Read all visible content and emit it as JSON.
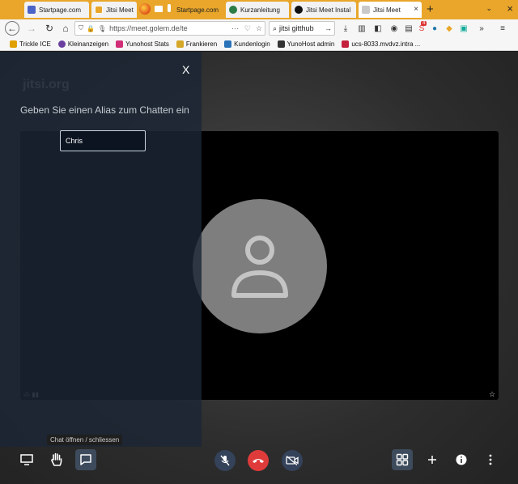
{
  "browser": {
    "tabs": [
      {
        "title": "Startpage.com",
        "favicon_color": "#4a63c7",
        "active": false
      },
      {
        "title": "Jitsi Meet",
        "favicon_color": "#ffffff",
        "active": false
      },
      {
        "title": "Startpage.com",
        "favicon_color": "#4a63c7",
        "active": false
      },
      {
        "title": "Kurzanleitung",
        "favicon_color": "#2d7d46",
        "active": false
      },
      {
        "title": "Jitsi Meet Instal",
        "favicon_color": "#111111",
        "active": false
      },
      {
        "title": "Jitsi Meet",
        "favicon_color": "#c9c9c9",
        "active": true
      }
    ],
    "tab_close": "×",
    "new_tab": "+",
    "tab_overflow": "⌄",
    "window_close": "×",
    "url": "https://meet.golem.de/te",
    "url_more": "···",
    "search_value": "jitsi gitthub",
    "search_go": "→",
    "addon_badge": "4"
  },
  "bookmarks": [
    {
      "label": "Trickle ICE",
      "icon_color": "#e0a000"
    },
    {
      "label": "Kleinanzeigen",
      "icon_color": "#6b3fa0"
    },
    {
      "label": "Yunohost Stats",
      "icon_color": "#d12e78"
    },
    {
      "label": "Frankieren",
      "icon_color": "#d6a82a"
    },
    {
      "label": "Kundenlogin",
      "icon_color": "#2a73b8"
    },
    {
      "label": "YunoHost admin",
      "icon_color": "#333333"
    },
    {
      "label": "ucs-8033.mvdvz.intra ...",
      "icon_color": "#c4213d"
    }
  ],
  "jitsi": {
    "watermark": "jitsi.org",
    "chat": {
      "close_label": "X",
      "heading": "Geben Sie einen Alias zum Chatten ein",
      "alias_value": "Chris"
    },
    "tooltip": "Chat öffnen / schliessen",
    "indicators": "⁂ ▮▮",
    "star": "☆"
  },
  "icons": {
    "screen": "desktop-icon",
    "hand": "raise-hand-icon",
    "chat": "chat-icon",
    "mic": "microphone-muted-icon",
    "hangup": "hangup-icon",
    "camera": "camera-off-icon",
    "tile": "tile-view-icon",
    "invite": "plus-icon",
    "info": "info-icon",
    "more": "more-vertical-icon"
  },
  "colors": {
    "tabstrip": "#e9a62a",
    "hangup": "#e03b3b",
    "chat_panel": "#1b2635",
    "accent_button": "#3d4b5c"
  }
}
